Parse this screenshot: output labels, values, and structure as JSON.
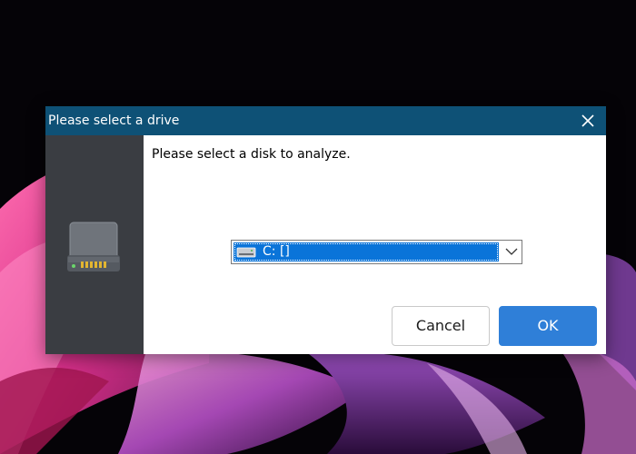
{
  "dialog": {
    "title": "Please select a drive",
    "prompt": "Please select a disk to analyze.",
    "drive_select": {
      "selected_value": "C: []"
    },
    "buttons": {
      "cancel_label": "Cancel",
      "ok_label": "OK"
    },
    "icons": {
      "side": "hard-drive-icon",
      "close": "close-icon",
      "select_arrow": "chevron-down-icon",
      "drive_item": "drive-icon"
    },
    "colors": {
      "titlebar": "#0e5176",
      "side_panel": "#3a3d42",
      "selection": "#0a74d9",
      "ok_button": "#2f7fd8"
    }
  },
  "desktop": {
    "wallpaper": "dark background with pink and purple abstract curves"
  }
}
